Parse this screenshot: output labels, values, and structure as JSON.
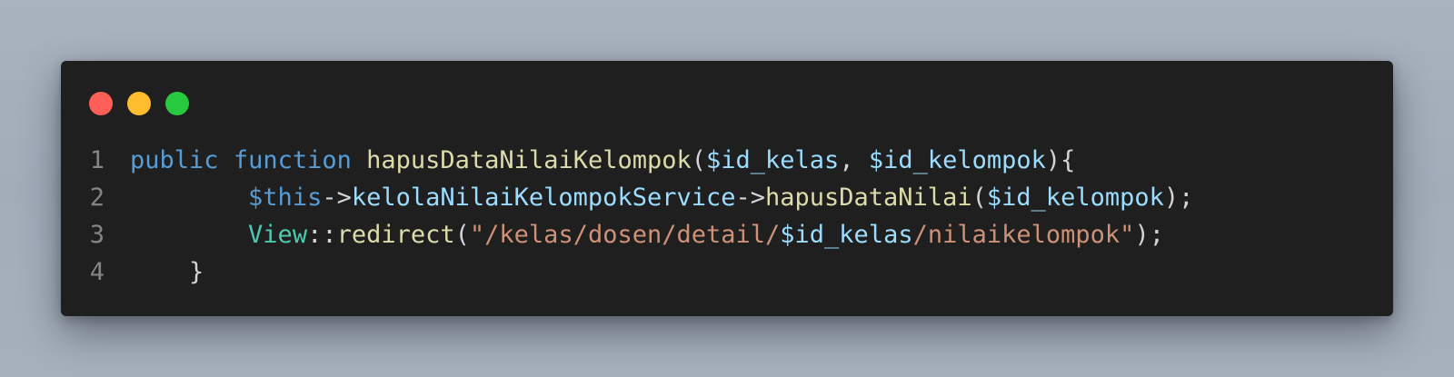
{
  "window": {
    "traffic_lights": [
      {
        "name": "close",
        "color": "#ff5f56"
      },
      {
        "name": "minimize",
        "color": "#ffbd2e"
      },
      {
        "name": "zoom",
        "color": "#27c93f"
      }
    ]
  },
  "code": {
    "lines": [
      {
        "number": "1",
        "tokens": [
          {
            "text": "public",
            "type": "kw"
          },
          {
            "text": " ",
            "type": "plain"
          },
          {
            "text": "function",
            "type": "kw"
          },
          {
            "text": " ",
            "type": "plain"
          },
          {
            "text": "hapusDataNilaiKelompok",
            "type": "fn"
          },
          {
            "text": "(",
            "type": "plain"
          },
          {
            "text": "$id_kelas",
            "type": "var"
          },
          {
            "text": ", ",
            "type": "plain"
          },
          {
            "text": "$id_kelompok",
            "type": "var"
          },
          {
            "text": "){",
            "type": "plain"
          }
        ]
      },
      {
        "number": "2",
        "tokens": [
          {
            "text": "        ",
            "type": "plain"
          },
          {
            "text": "$this",
            "type": "kw"
          },
          {
            "text": "->",
            "type": "plain"
          },
          {
            "text": "kelolaNilaiKelompokService",
            "type": "var"
          },
          {
            "text": "->",
            "type": "plain"
          },
          {
            "text": "hapusDataNilai",
            "type": "fn"
          },
          {
            "text": "(",
            "type": "plain"
          },
          {
            "text": "$id_kelompok",
            "type": "var"
          },
          {
            "text": ");",
            "type": "plain"
          }
        ]
      },
      {
        "number": "3",
        "tokens": [
          {
            "text": "        ",
            "type": "plain"
          },
          {
            "text": "View",
            "type": "cls"
          },
          {
            "text": "::",
            "type": "plain"
          },
          {
            "text": "redirect",
            "type": "fn"
          },
          {
            "text": "(",
            "type": "plain"
          },
          {
            "text": "\"/kelas/dosen/detail/",
            "type": "str"
          },
          {
            "text": "$id_kelas",
            "type": "var"
          },
          {
            "text": "/nilaikelompok\"",
            "type": "str"
          },
          {
            "text": ");",
            "type": "plain"
          }
        ]
      },
      {
        "number": "4",
        "tokens": [
          {
            "text": "    ",
            "type": "plain"
          },
          {
            "text": "}",
            "type": "plain"
          }
        ]
      }
    ]
  }
}
